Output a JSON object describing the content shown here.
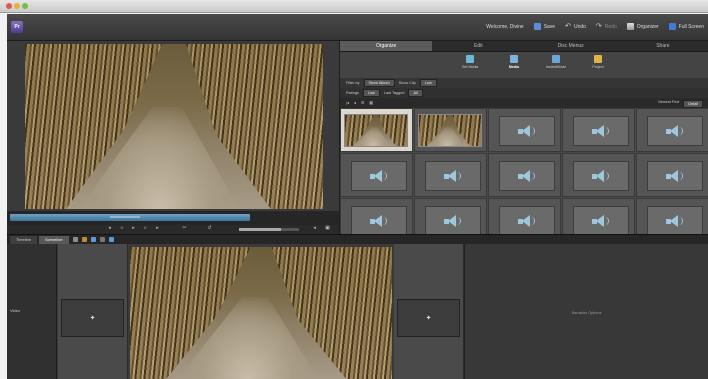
{
  "menubar": {
    "app_logo_text": "Pr",
    "items": [
      {
        "label": "Welcome, Divine",
        "icon": ""
      },
      {
        "label": "Save",
        "icon": "save-icon"
      },
      {
        "label": "Undo",
        "icon": "undo-icon"
      },
      {
        "label": "Redo",
        "icon": "redo-icon",
        "disabled": true
      },
      {
        "label": "Organizer",
        "icon": "organizer-icon"
      },
      {
        "label": "Full Screen",
        "icon": "full-screen-icon"
      }
    ]
  },
  "organizer": {
    "tabs": [
      "Organize",
      "Edit",
      "Disc Menus",
      "Share"
    ],
    "active_tab": "Organize",
    "tools": [
      {
        "label": "Get Media",
        "color": "#6fb7d6"
      },
      {
        "label": "Media",
        "color": "#7fb4e0"
      },
      {
        "label": "InstantMovie",
        "color": "#6aa6d8"
      },
      {
        "label": "Project",
        "color": "#e2b24a"
      }
    ],
    "active_tool": "Media",
    "filter_row1": {
      "label": "Filter by",
      "value1": "Show Album",
      "label2": "Show Clip",
      "value2": "Low"
    },
    "filter_row2": {
      "label": "Ratings",
      "value1": "Low",
      "label2": "Last Tagged",
      "value2": "All"
    },
    "view_label": "Newest First",
    "view_value": "Detail"
  },
  "timeline": {
    "tabs": [
      "Timeline",
      "Sceneline"
    ],
    "active_tab": "Sceneline",
    "track_label": "Video",
    "drop_zone_text": "Narration Options"
  },
  "colors": {
    "accent": "#5d9bd5",
    "selection": "#ddd8cf"
  }
}
